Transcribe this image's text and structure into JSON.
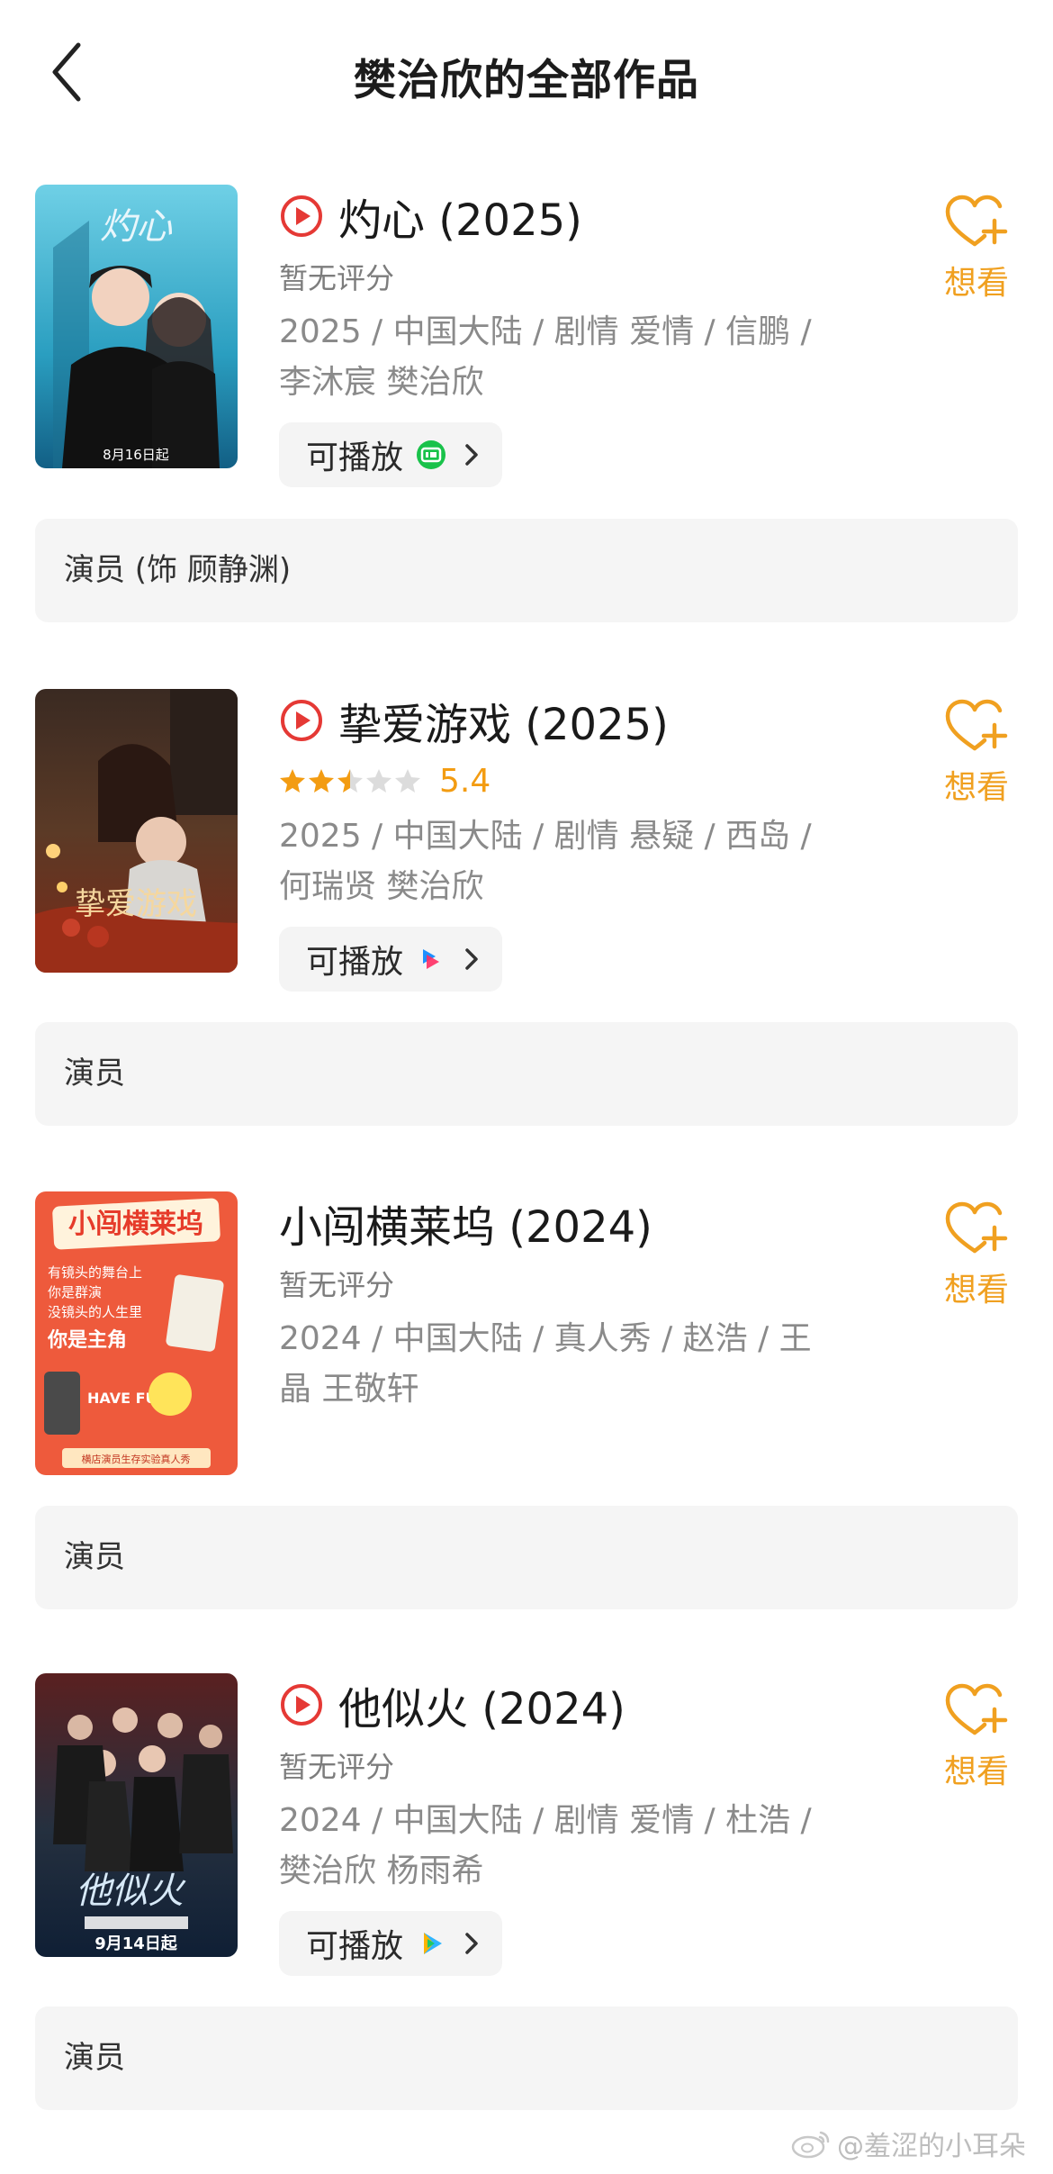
{
  "header": {
    "title": "樊治欣的全部作品"
  },
  "works": [
    {
      "title": "灼心 (2025)",
      "has_play_icon": true,
      "rating_text": "暂无评分",
      "score": null,
      "meta_line1": "2025 / 中国大陆 / 剧情 爱情 / 信鹏 /",
      "meta_line2": "李沐宸 樊治欣",
      "play_label": "可播放",
      "platform_icon": "iqiyi-icon",
      "want_label": "想看",
      "role": "演员 (饰 顾静渊)",
      "poster_caption": "8月16日起",
      "poster_title": "灼心"
    },
    {
      "title": "挚爱游戏 (2025)",
      "has_play_icon": true,
      "rating_text": "",
      "score": "5.4",
      "stars": 2.5,
      "meta_line1": "2025 / 中国大陆 / 剧情 悬疑 / 西岛 /",
      "meta_line2": "何瑞贤 樊治欣",
      "play_label": "可播放",
      "platform_icon": "youku-icon",
      "want_label": "想看",
      "role": "演员",
      "poster_title": "挚爱游戏"
    },
    {
      "title": "小闯横莱坞 (2024)",
      "has_play_icon": false,
      "rating_text": "暂无评分",
      "score": null,
      "meta_line1": "2024 / 中国大陆 / 真人秀 / 赵浩 / 王",
      "meta_line2": "晶 王敬轩",
      "want_label": "想看",
      "role": "演员",
      "poster_title": "小闯横莱坞",
      "poster_text1": "有镜头的舞台上",
      "poster_text2": "你是群演",
      "poster_text3": "没镜头的人生里",
      "poster_text4": "你是主角",
      "poster_text5": "HAVE FUN!!",
      "poster_text6": "横店演员生存实验真人秀"
    },
    {
      "title": "他似火 (2024)",
      "has_play_icon": true,
      "rating_text": "暂无评分",
      "score": null,
      "meta_line1": "2024 / 中国大陆 / 剧情 爱情 / 杜浩 /",
      "meta_line2": "樊治欣 杨雨希",
      "play_label": "可播放",
      "platform_icon": "tencent-video-icon",
      "want_label": "想看",
      "role": "演员",
      "poster_caption": "9月14日起",
      "poster_title": "他似火"
    }
  ],
  "watermark": "@羞涩的小耳朵",
  "colors": {
    "accent": "#f0a020",
    "play_red": "#e53935",
    "score": "#f39c12"
  }
}
